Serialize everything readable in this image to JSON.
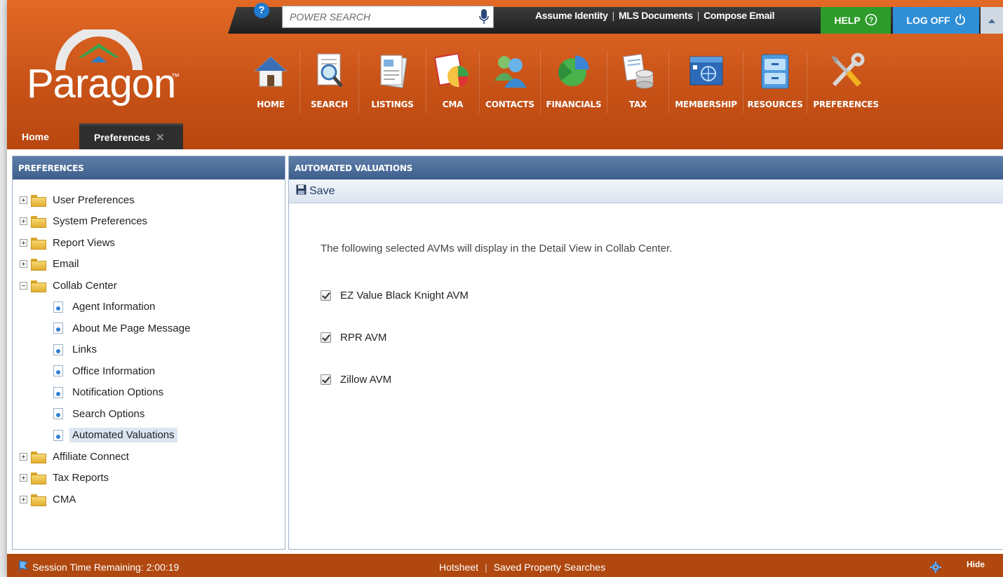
{
  "header": {
    "brand": "Paragon",
    "trademark": "™",
    "help_mark": "?",
    "search": {
      "placeholder": "POWER SEARCH"
    },
    "top_links": [
      "Assume Identity",
      "MLS Documents",
      "Compose Email"
    ],
    "help_label": "HELP",
    "logoff_label": "LOG OFF"
  },
  "nav": [
    {
      "label": "HOME",
      "icon": "house-icon"
    },
    {
      "label": "SEARCH",
      "icon": "magnifier-document-icon"
    },
    {
      "label": "LISTINGS",
      "icon": "listing-document-icon"
    },
    {
      "label": "CMA",
      "icon": "pie-chart-report-icon"
    },
    {
      "label": "CONTACTS",
      "icon": "people-icon"
    },
    {
      "label": "FINANCIALS",
      "icon": "pie-chart-icon"
    },
    {
      "label": "TAX",
      "icon": "tax-database-icon"
    },
    {
      "label": "MEMBERSHIP",
      "icon": "network-window-icon"
    },
    {
      "label": "RESOURCES",
      "icon": "filing-cabinet-icon"
    },
    {
      "label": "PREFERENCES",
      "icon": "tools-icon"
    }
  ],
  "tabs": {
    "home": "Home",
    "preferences": "Preferences",
    "close": "✕"
  },
  "left_panel": {
    "title": "PREFERENCES",
    "tree": [
      {
        "label": "User Preferences",
        "type": "folder",
        "expanded": false
      },
      {
        "label": "System Preferences",
        "type": "folder",
        "expanded": false
      },
      {
        "label": "Report Views",
        "type": "folder",
        "expanded": false
      },
      {
        "label": "Email",
        "type": "folder",
        "expanded": false
      },
      {
        "label": "Collab Center",
        "type": "folder",
        "expanded": true
      },
      {
        "label": "Agent Information",
        "type": "page"
      },
      {
        "label": "About Me Page Message",
        "type": "page"
      },
      {
        "label": "Links",
        "type": "page"
      },
      {
        "label": "Office Information",
        "type": "page"
      },
      {
        "label": "Notification Options",
        "type": "page"
      },
      {
        "label": "Search Options",
        "type": "page"
      },
      {
        "label": "Automated Valuations",
        "type": "page",
        "selected": true
      },
      {
        "label": "Affiliate Connect",
        "type": "folder",
        "expanded": false
      },
      {
        "label": "Tax Reports",
        "type": "folder",
        "expanded": false
      },
      {
        "label": "CMA",
        "type": "folder",
        "expanded": false
      }
    ]
  },
  "right_panel": {
    "title": "AUTOMATED VALUATIONS",
    "save_label": "Save",
    "intro": "The following selected AVMs will display in the Detail View in Collab Center.",
    "options": [
      {
        "label": "EZ Value Black Knight AVM",
        "checked": true
      },
      {
        "label": "RPR AVM",
        "checked": true
      },
      {
        "label": "Zillow AVM",
        "checked": true
      }
    ]
  },
  "footer": {
    "session_label": "Session Time Remaining: 2:00:19",
    "links": [
      "Hotsheet",
      "Saved Property Searches"
    ],
    "hide_label": "Hide"
  },
  "colors": {
    "header_orange": "#c95318",
    "panel_header_blue": "#3e5f8d",
    "help_green": "#2d9b2a",
    "logoff_blue": "#2f8fd6",
    "footer_orange": "#b0480f"
  }
}
